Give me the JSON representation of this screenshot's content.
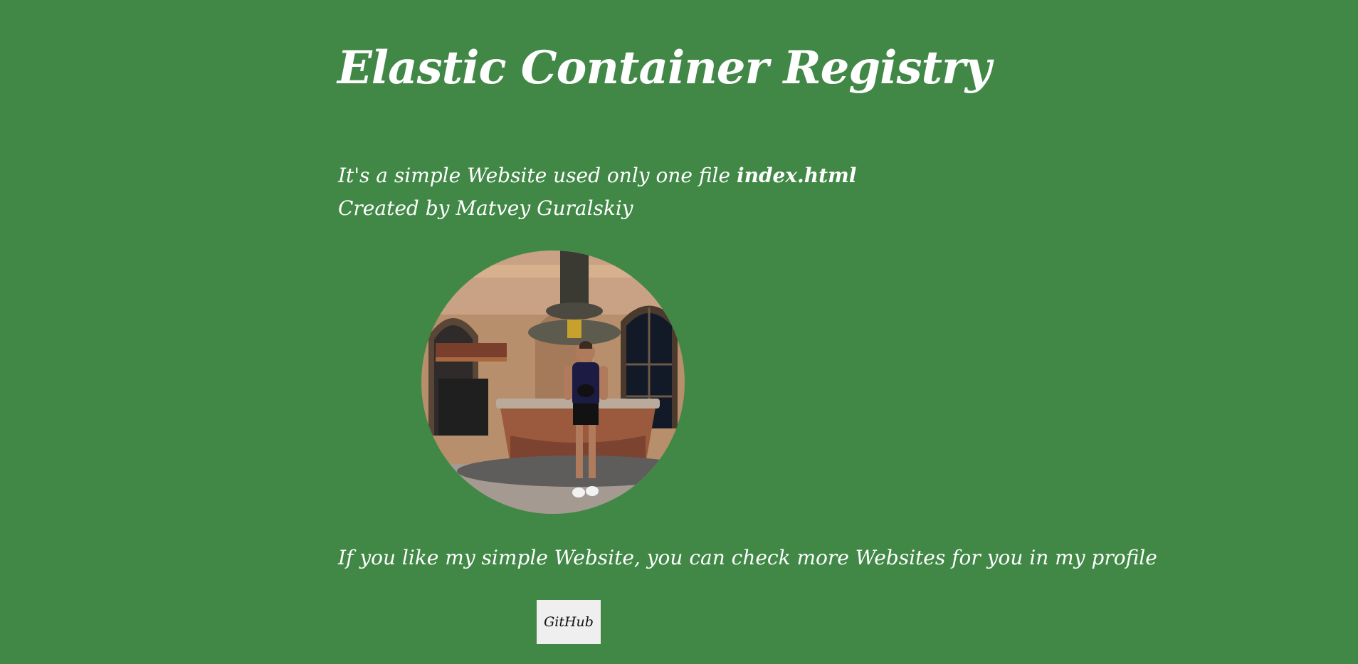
{
  "page": {
    "background_color": "#418847",
    "text_color": "#ffffff"
  },
  "header": {
    "title": "Elastic Container Registry"
  },
  "intro": {
    "line1_text": "It's a simple Website used only one file ",
    "line1_filename": "index.html",
    "line2_text": "Created by Matvey Guralskiy"
  },
  "photo": {
    "shape": "circle",
    "subject": "man standing in front of a fountain in a courtyard"
  },
  "footer": {
    "cta_text": "If you like my simple Website, you can check more Websites for you in my profile",
    "github_button_label": "GitHub",
    "button_color": "#efefef"
  }
}
